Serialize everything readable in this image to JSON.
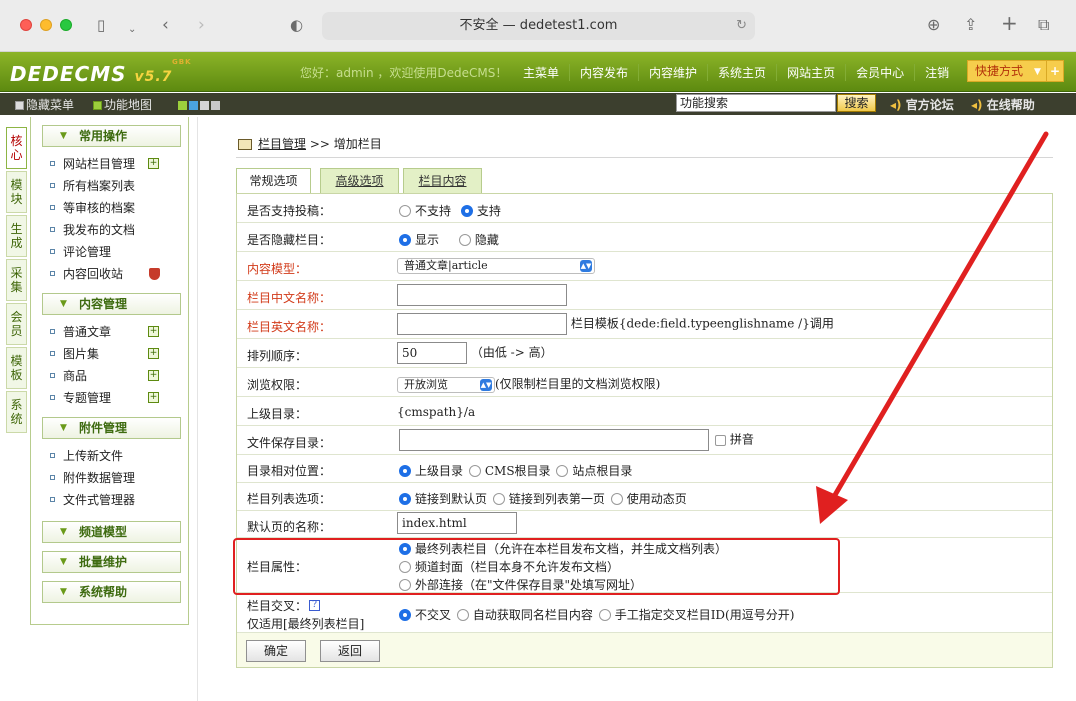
{
  "browser": {
    "url": "不安全 — dedetest1.com"
  },
  "header": {
    "logo_text": "DEDECMS",
    "logo_version": "v5.7",
    "logo_sup": "GBK",
    "greeting": "您好：admin ，欢迎使用DedeCMS！",
    "nav": [
      "主菜单",
      "内容发布",
      "内容维护",
      "系统主页",
      "网站主页",
      "会员中心",
      "注销"
    ],
    "quick": "快捷方式"
  },
  "toolbar": {
    "hide_menu": "隐藏菜单",
    "func_map": "功能地图",
    "search_value": "功能搜索",
    "search_btn": "搜索",
    "forum": "官方论坛",
    "help": "在线帮助"
  },
  "left_tabs": [
    "核心",
    "模块",
    "生成",
    "采集",
    "会员",
    "模板",
    "系统"
  ],
  "sidebar": {
    "common_title": "常用操作",
    "common_items": [
      "网站栏目管理",
      "所有档案列表",
      "等审核的档案",
      "我发布的文档",
      "评论管理",
      "内容回收站"
    ],
    "content_title": "内容管理",
    "content_items": [
      "普通文章",
      "图片集",
      "商品",
      "专题管理"
    ],
    "attach_title": "附件管理",
    "attach_items": [
      "上传新文件",
      "附件数据管理",
      "文件式管理器"
    ],
    "channel_title": "频道模型",
    "batch_title": "批量维护",
    "help_title": "系统帮助"
  },
  "crumb": {
    "link": "栏目管理",
    "rest": ">> 增加栏目"
  },
  "tabs": [
    "常规选项",
    "高级选项",
    "栏目内容"
  ],
  "form": {
    "contribute": {
      "label": "是否支持投稿：",
      "opt1": "不支持",
      "opt2": "支持"
    },
    "hidden": {
      "label": "是否隐藏栏目：",
      "opt1": "显示",
      "opt2": "隐藏"
    },
    "model": {
      "label": "内容模型：",
      "value": "普通文章|article"
    },
    "cname": {
      "label": "栏目中文名称："
    },
    "ename": {
      "label": "栏目英文名称：",
      "hint": "栏目模板{dede:field.typeenglishname /}调用"
    },
    "sort": {
      "label": "排列顺序：",
      "value": "50",
      "hint": "（由低 -> 高）"
    },
    "perm": {
      "label": "浏览权限：",
      "value": "开放浏览",
      "hint": "(仅限制栏目里的文档浏览权限)"
    },
    "parent": {
      "label": "上级目录：",
      "value": "{cmspath}/a"
    },
    "savedir": {
      "label": "文件保存目录：",
      "pinyin": "拼音"
    },
    "reldir": {
      "label": "目录相对位置：",
      "opt1": "上级目录",
      "opt2": "CMS根目录",
      "opt3": "站点根目录"
    },
    "listopt": {
      "label": "栏目列表选项：",
      "opt1": "链接到默认页",
      "opt2": "链接到列表第一页",
      "opt3": "使用动态页"
    },
    "defpage": {
      "label": "默认页的名称：",
      "value": "index.html"
    },
    "attr": {
      "label": "栏目属性：",
      "opt1": "最终列表栏目（允许在本栏目发布文档，并生成文档列表）",
      "opt2": "频道封面（栏目本身不允许发布文档）",
      "opt3": "外部连接（在\"文件保存目录\"处填写网址）"
    },
    "cross": {
      "label": "栏目交叉：",
      "label2": "仅适用[最终列表栏目]",
      "opt1": "不交叉",
      "opt2": "自动获取同名栏目内容",
      "opt3": "手工指定交叉栏目ID(用逗号分开)"
    },
    "ok": "确定",
    "back": "返回"
  },
  "colors": {
    "header_green": "#6f9a1a",
    "highlight_red": "#e02020",
    "radio_blue": "#1e6fe6"
  }
}
